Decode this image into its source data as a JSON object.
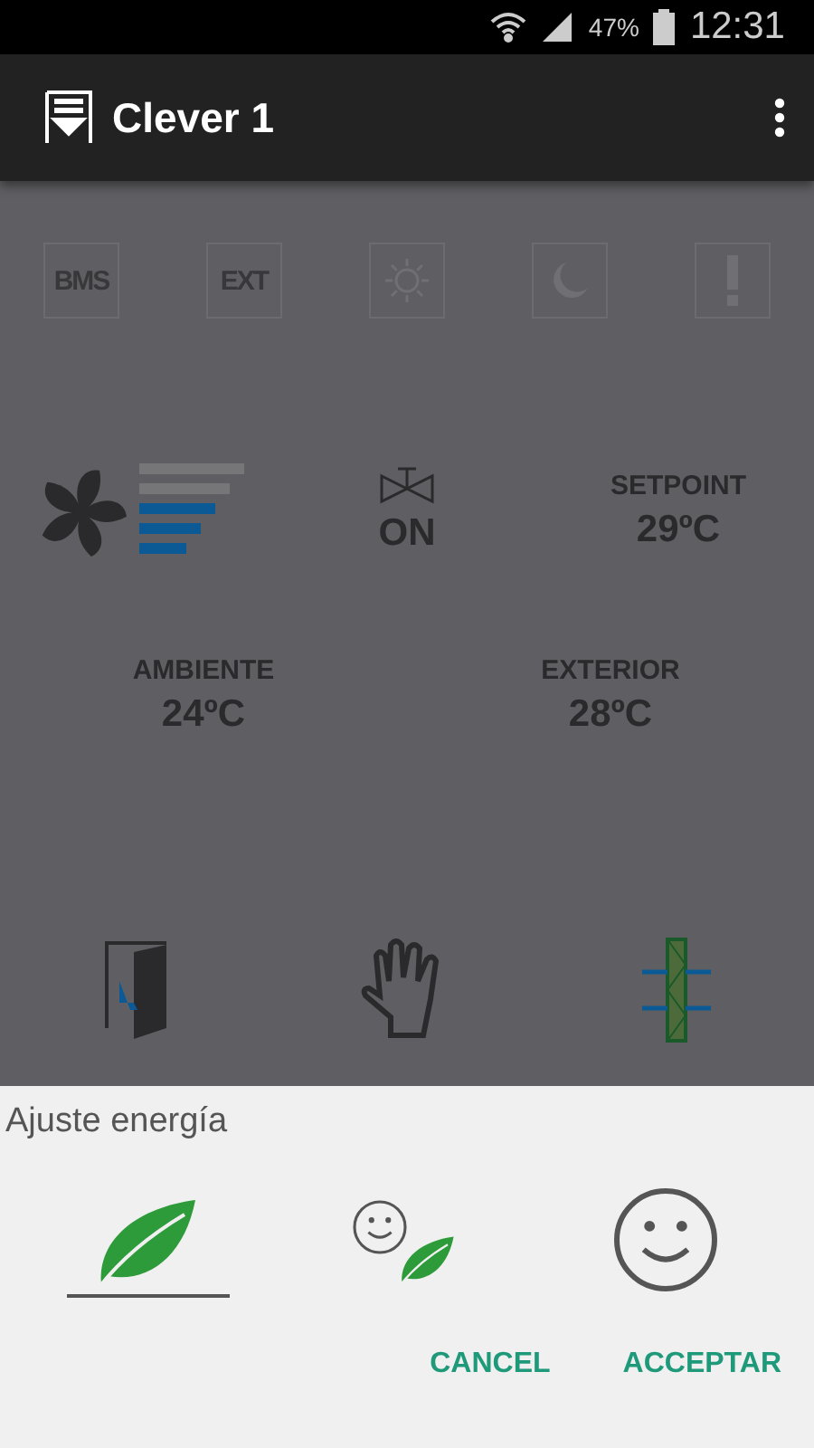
{
  "status_bar": {
    "battery": "47%",
    "time": "12:31"
  },
  "app_bar": {
    "title": "Clever 1"
  },
  "modes": [
    {
      "kind": "text",
      "label": "BMS"
    },
    {
      "kind": "text",
      "label": "EXT"
    },
    {
      "kind": "sun"
    },
    {
      "kind": "moon"
    },
    {
      "kind": "alert"
    }
  ],
  "fan": {
    "level": 0.6
  },
  "valve": {
    "state": "ON"
  },
  "setpoint": {
    "label": "SETPOINT",
    "value": "29ºC"
  },
  "readings": [
    {
      "label": "AMBIENTE",
      "value": "24ºC"
    },
    {
      "label": "EXTERIOR",
      "value": "28ºC"
    }
  ],
  "dialog": {
    "title": "Ajuste energía",
    "options": [
      {
        "kind": "eco",
        "selected": true
      },
      {
        "kind": "mixed",
        "selected": false
      },
      {
        "kind": "comfort",
        "selected": false
      }
    ],
    "buttons": [
      "CANCEL",
      "ACCEPTAR"
    ]
  }
}
